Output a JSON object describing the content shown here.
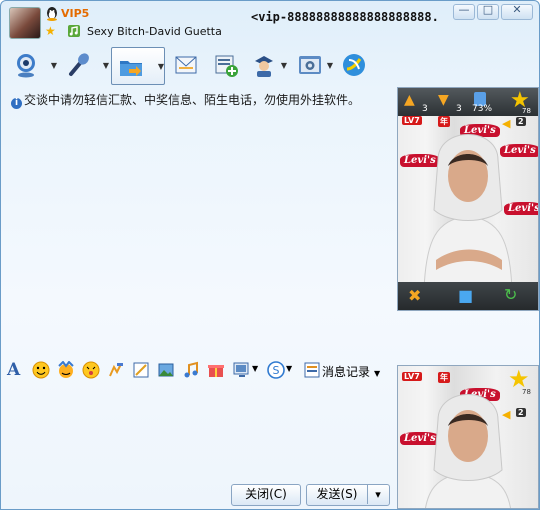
{
  "title_bar": {
    "vip_label": "VIP5",
    "signature": "Sexy Bitch-David Guetta",
    "contact_name": "<vip-88888888888888888888...",
    "window_buttons": [
      "minimize-icon",
      "maximize-icon",
      "close-icon"
    ],
    "minimize_glyph": "—",
    "maximize_glyph": "□",
    "close_glyph": "✕"
  },
  "toolbar": {
    "items": [
      "webcam-icon",
      "microphone-icon",
      "file-transfer-icon",
      "email-icon",
      "add-app-icon",
      "remote-assist-icon",
      "settings-icon",
      "qzone-icon"
    ]
  },
  "notice": {
    "text": "交谈中请勿轻信汇款、中奖信息、陌生电话，勿使用外挂软件。"
  },
  "show_panel": {
    "stats": [
      "3",
      "3",
      "73%",
      "78"
    ],
    "level": "LV7",
    "year_badge": "年",
    "volume": "2",
    "logo": "Levi's"
  },
  "format_bar": {
    "font_glyph": "A",
    "message_log": "消息记录"
  },
  "own_avatar": {
    "level": "LV7",
    "year_badge": "年",
    "volume": "2",
    "star_count": "78",
    "logo": "Levi's"
  },
  "buttons": {
    "close": "关闭(C)",
    "send": "发送(S)",
    "send_menu_arrow": "▾"
  },
  "colors": {
    "accent": "#2f6fc2",
    "vip": "#e46b00",
    "badge_red": "#d61a1a"
  }
}
